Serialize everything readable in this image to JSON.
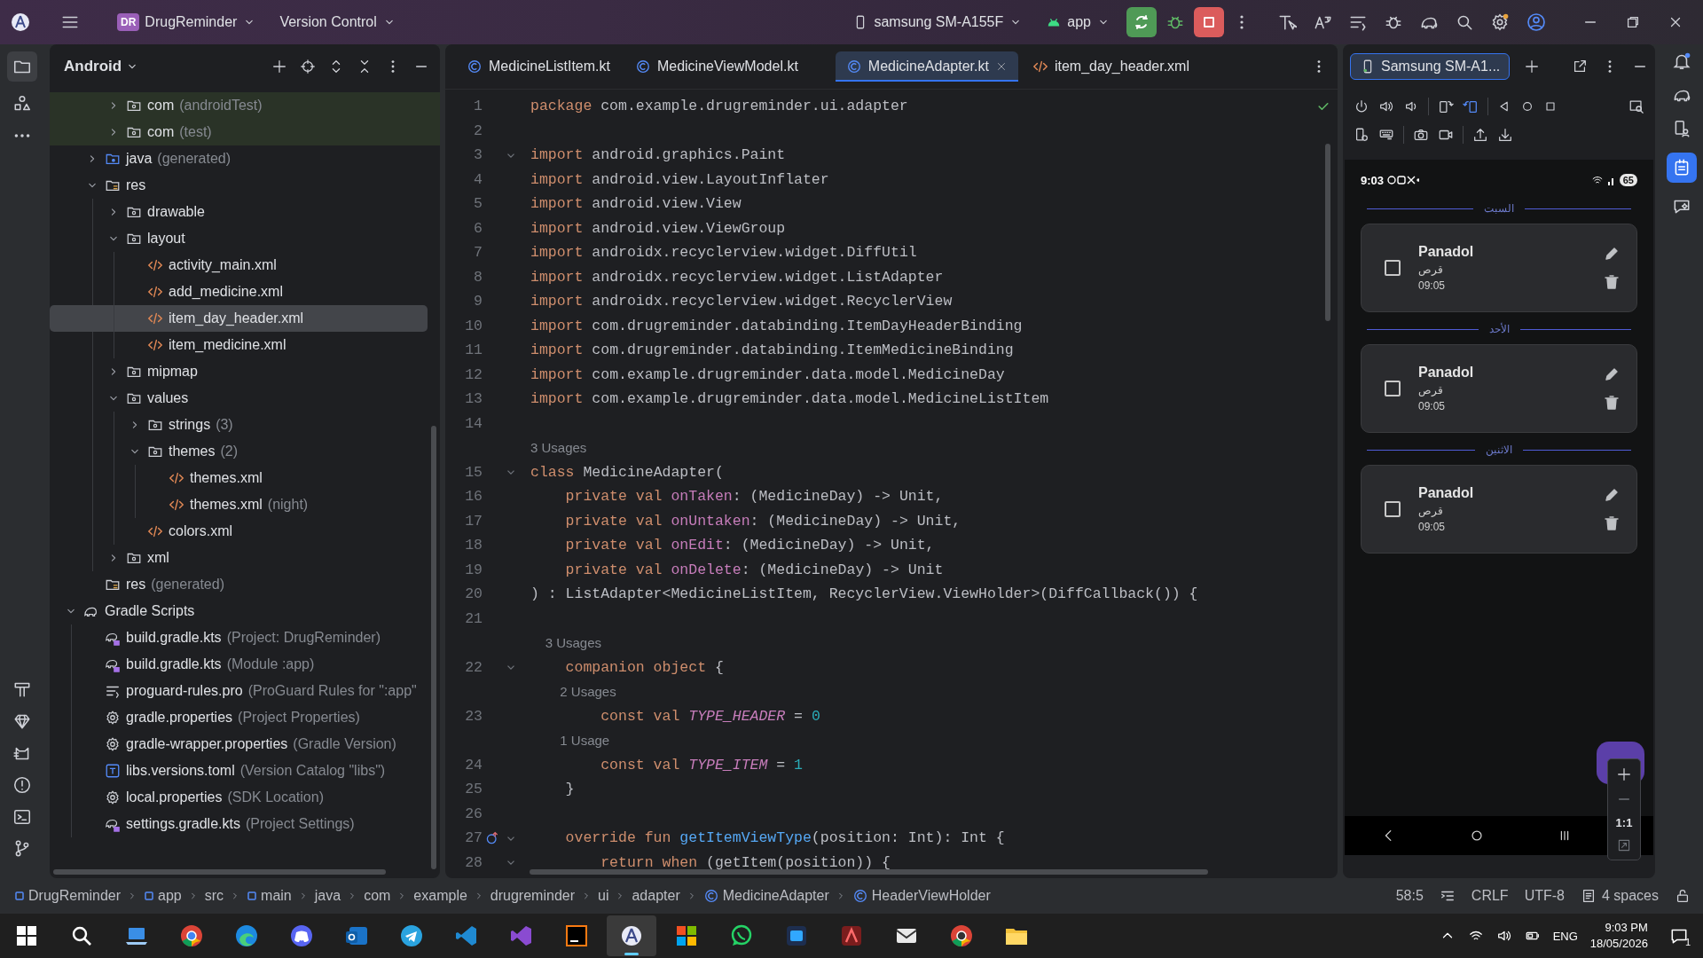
{
  "title_bar": {
    "project_badge": "DR",
    "project": "DrugReminder",
    "vcs": "Version Control",
    "device": "samsung SM-A155F",
    "run_config": "app"
  },
  "project_panel": {
    "view": "Android",
    "tree": [
      {
        "children": [
          {
            "children": [
              {
                "label": "com",
                "note": "(androidTest)",
                "kind": "package",
                "expanded": false,
                "test": true,
                "selected": false
              },
              {
                "label": "com",
                "note": "(test)",
                "kind": "package",
                "expanded": false,
                "test": true,
                "selected": false
              }
            ]
          },
          {
            "label": "java",
            "note": "(generated)",
            "kind": "generated",
            "expanded": false,
            "selected": false
          },
          {
            "label": "res",
            "kind": "res",
            "expanded": true,
            "selected": false,
            "children": [
              {
                "label": "drawable",
                "kind": "package",
                "expanded": false,
                "selected": false
              },
              {
                "label": "layout",
                "kind": "package",
                "expanded": true,
                "selected": false,
                "children": [
                  {
                    "label": "activity_main.xml",
                    "kind": "xml",
                    "selected": false
                  },
                  {
                    "label": "add_medicine.xml",
                    "kind": "xml",
                    "selected": false
                  },
                  {
                    "label": "item_day_header.xml",
                    "kind": "xml",
                    "selected": true
                  },
                  {
                    "label": "item_medicine.xml",
                    "kind": "xml",
                    "selected": false
                  }
                ]
              },
              {
                "label": "mipmap",
                "kind": "package",
                "expanded": false,
                "selected": false
              },
              {
                "label": "values",
                "kind": "package",
                "expanded": true,
                "selected": false,
                "children": [
                  {
                    "label": "strings",
                    "note": "(3)",
                    "kind": "package",
                    "expanded": false,
                    "selected": false
                  },
                  {
                    "label": "themes",
                    "note": "(2)",
                    "kind": "package",
                    "expanded": true,
                    "selected": false,
                    "children": [
                      {
                        "label": "themes.xml",
                        "kind": "xml",
                        "selected": false
                      },
                      {
                        "label": "themes.xml",
                        "note": "(night)",
                        "kind": "xml",
                        "selected": false
                      }
                    ]
                  },
                  {
                    "label": "colors.xml",
                    "kind": "xml",
                    "selected": false
                  }
                ]
              },
              {
                "label": "xml",
                "kind": "package",
                "expanded": false,
                "selected": false
              }
            ]
          },
          {
            "label": "res",
            "note": "(generated)",
            "kind": "res",
            "selected": false
          }
        ]
      },
      {
        "label": "Gradle Scripts",
        "kind": "gradle-scripts",
        "expanded": true,
        "selected": false,
        "children": [
          {
            "label": "build.gradle.kts",
            "note": "(Project: DrugReminder)",
            "kind": "gradle",
            "selected": false
          },
          {
            "label": "build.gradle.kts",
            "note": "(Module :app)",
            "kind": "gradle",
            "selected": false
          },
          {
            "label": "proguard-rules.pro",
            "note": "(ProGuard Rules for \":app\"",
            "kind": "text",
            "selected": false
          },
          {
            "label": "gradle.properties",
            "note": "(Project Properties)",
            "kind": "properties",
            "selected": false
          },
          {
            "label": "gradle-wrapper.properties",
            "note": "(Gradle Version)",
            "kind": "properties",
            "selected": false
          },
          {
            "label": "libs.versions.toml",
            "note": "(Version Catalog \"libs\")",
            "kind": "toml",
            "selected": false
          },
          {
            "label": "local.properties",
            "note": "(SDK Location)",
            "kind": "properties",
            "selected": false
          },
          {
            "label": "settings.gradle.kts",
            "note": "(Project Settings)",
            "kind": "gradle",
            "selected": false
          }
        ]
      }
    ]
  },
  "editor": {
    "tabs": [
      {
        "label": "MedicineListItem.kt",
        "kind": "kotlin",
        "selected": false
      },
      {
        "label": "MedicineViewModel.kt",
        "kind": "kotlin",
        "selected": false
      },
      {
        "label": "MedicineAdapter.kt",
        "kind": "kotlin",
        "selected": true
      },
      {
        "label": "item_day_header.xml",
        "kind": "xml",
        "selected": false
      }
    ],
    "lines": [
      {
        "kind": "code",
        "number": "1",
        "fold": false,
        "segments": [
          {
            "kind": "keyword",
            "text": "package"
          },
          {
            "kind": "plain",
            "text": " com.example.drugreminder.ui.adapter"
          }
        ]
      },
      {
        "kind": "code",
        "number": "2",
        "fold": false
      },
      {
        "kind": "code",
        "number": "3",
        "fold": true,
        "segments": [
          {
            "kind": "keyword",
            "text": "import"
          },
          {
            "kind": "plain",
            "text": " android.graphics.Paint"
          }
        ]
      },
      {
        "kind": "code",
        "number": "4",
        "fold": false,
        "segments": [
          {
            "kind": "keyword",
            "text": "import"
          },
          {
            "kind": "plain",
            "text": " android.view.LayoutInflater"
          }
        ]
      },
      {
        "kind": "code",
        "number": "5",
        "fold": false,
        "segments": [
          {
            "kind": "keyword",
            "text": "import"
          },
          {
            "kind": "plain",
            "text": " android.view.View"
          }
        ]
      },
      {
        "kind": "code",
        "number": "6",
        "fold": false,
        "segments": [
          {
            "kind": "keyword",
            "text": "import"
          },
          {
            "kind": "plain",
            "text": " android.view.ViewGroup"
          }
        ]
      },
      {
        "kind": "code",
        "number": "7",
        "fold": false,
        "segments": [
          {
            "kind": "keyword",
            "text": "import"
          },
          {
            "kind": "plain",
            "text": " androidx.recyclerview.widget.DiffUtil"
          }
        ]
      },
      {
        "kind": "code",
        "number": "8",
        "fold": false,
        "segments": [
          {
            "kind": "keyword",
            "text": "import"
          },
          {
            "kind": "plain",
            "text": " androidx.recyclerview.widget.ListAdapter"
          }
        ]
      },
      {
        "kind": "code",
        "number": "9",
        "fold": false,
        "segments": [
          {
            "kind": "keyword",
            "text": "import"
          },
          {
            "kind": "plain",
            "text": " androidx.recyclerview.widget.RecyclerView"
          }
        ]
      },
      {
        "kind": "code",
        "number": "10",
        "fold": false,
        "segments": [
          {
            "kind": "keyword",
            "text": "import"
          },
          {
            "kind": "plain",
            "text": " com.drugreminder.databinding.ItemDayHeaderBinding"
          }
        ]
      },
      {
        "kind": "code",
        "number": "11",
        "fold": false,
        "segments": [
          {
            "kind": "keyword",
            "text": "import"
          },
          {
            "kind": "plain",
            "text": " com.drugreminder.databinding.ItemMedicineBinding"
          }
        ]
      },
      {
        "kind": "code",
        "number": "12",
        "fold": false,
        "segments": [
          {
            "kind": "keyword",
            "text": "import"
          },
          {
            "kind": "plain",
            "text": " com.example.drugreminder.data.model.MedicineDay"
          }
        ]
      },
      {
        "kind": "code",
        "number": "13",
        "fold": false,
        "segments": [
          {
            "kind": "keyword",
            "text": "import"
          },
          {
            "kind": "plain",
            "text": " com.example.drugreminder.data.model.MedicineListItem"
          }
        ]
      },
      {
        "kind": "code",
        "number": "14",
        "fold": false
      },
      {
        "kind": "hint",
        "text": "3 Usages"
      },
      {
        "kind": "code",
        "number": "15",
        "fold": true,
        "segments": [
          {
            "kind": "keyword",
            "text": "class"
          },
          {
            "kind": "plain",
            "text": " MedicineAdapter("
          }
        ]
      },
      {
        "kind": "code",
        "number": "16",
        "fold": false,
        "segments": [
          {
            "kind": "keyword",
            "text": "    private val "
          },
          {
            "kind": "property",
            "text": "onTaken"
          },
          {
            "kind": "plain",
            "text": ": (MedicineDay) -> Unit,"
          }
        ]
      },
      {
        "kind": "code",
        "number": "17",
        "fold": false,
        "segments": [
          {
            "kind": "keyword",
            "text": "    private val "
          },
          {
            "kind": "property",
            "text": "onUntaken"
          },
          {
            "kind": "plain",
            "text": ": (MedicineDay) -> Unit,"
          }
        ]
      },
      {
        "kind": "code",
        "number": "18",
        "fold": false,
        "segments": [
          {
            "kind": "keyword",
            "text": "    private val "
          },
          {
            "kind": "property",
            "text": "onEdit"
          },
          {
            "kind": "plain",
            "text": ": (MedicineDay) -> Unit,"
          }
        ]
      },
      {
        "kind": "code",
        "number": "19",
        "fold": false,
        "segments": [
          {
            "kind": "keyword",
            "text": "    private val "
          },
          {
            "kind": "property",
            "text": "onDelete"
          },
          {
            "kind": "plain",
            "text": ": (MedicineDay) -> Unit"
          }
        ]
      },
      {
        "kind": "code",
        "number": "20",
        "fold": false,
        "segments": [
          {
            "kind": "plain",
            "text": ") : ListAdapter<MedicineListItem, RecyclerView.ViewHolder>(DiffCallback()) {"
          }
        ]
      },
      {
        "kind": "code",
        "number": "21",
        "fold": false
      },
      {
        "kind": "hint",
        "text": "    3 Usages"
      },
      {
        "kind": "code",
        "number": "22",
        "fold": true,
        "segments": [
          {
            "kind": "keyword",
            "text": "    companion object"
          },
          {
            "kind": "plain",
            "text": " {"
          }
        ]
      },
      {
        "kind": "hint",
        "text": "        2 Usages"
      },
      {
        "kind": "code",
        "number": "23",
        "fold": false,
        "segments": [
          {
            "kind": "keyword",
            "text": "        const val "
          },
          {
            "kind": "constant",
            "text": "TYPE_HEADER"
          },
          {
            "kind": "plain",
            "text": " = "
          },
          {
            "kind": "number",
            "text": "0"
          }
        ]
      },
      {
        "kind": "hint",
        "text": "        1 Usage"
      },
      {
        "kind": "code",
        "number": "24",
        "fold": false,
        "segments": [
          {
            "kind": "keyword",
            "text": "        const val "
          },
          {
            "kind": "constant",
            "text": "TYPE_ITEM"
          },
          {
            "kind": "plain",
            "text": " = "
          },
          {
            "kind": "number",
            "text": "1"
          }
        ]
      },
      {
        "kind": "code",
        "number": "25",
        "fold": false,
        "segments": [
          {
            "kind": "plain",
            "text": "    }"
          }
        ]
      },
      {
        "kind": "code",
        "number": "26",
        "fold": false
      },
      {
        "kind": "code",
        "number": "27",
        "fold": true,
        "override": true,
        "segments": [
          {
            "kind": "keyword",
            "text": "    override fun "
          },
          {
            "kind": "function",
            "text": "getItemViewType"
          },
          {
            "kind": "plain",
            "text": "(position: Int): Int {"
          }
        ]
      },
      {
        "kind": "code",
        "number": "28",
        "fold": true,
        "segments": [
          {
            "kind": "keyword",
            "text": "        return when"
          },
          {
            "kind": "plain",
            "text": " (getItem(position)) {"
          }
        ]
      }
    ]
  },
  "devices_panel": {
    "tab": "Samsung SM-A1...",
    "phone": {
      "time": "9:03",
      "battery": "65",
      "zoom_label": "1:1",
      "days": [
        {
          "title": "السبت",
          "items": [
            {
              "name": "Panadol",
              "form": "قرص",
              "time": "09:05",
              "checked": false
            }
          ]
        },
        {
          "title": "الأحد",
          "items": [
            {
              "name": "Panadol",
              "form": "قرص",
              "time": "09:05",
              "checked": false
            }
          ]
        },
        {
          "title": "الاثنين",
          "items": [
            {
              "name": "Panadol",
              "form": "قرص",
              "time": "09:05",
              "checked": false
            }
          ]
        }
      ]
    }
  },
  "status_bar": {
    "breadcrumbs": [
      {
        "label": "DrugReminder",
        "kind": "module"
      },
      {
        "label": "app",
        "kind": "module"
      },
      {
        "label": "src",
        "kind": "plain"
      },
      {
        "label": "main",
        "kind": "module"
      },
      {
        "label": "java",
        "kind": "plain"
      },
      {
        "label": "com",
        "kind": "plain"
      },
      {
        "label": "example",
        "kind": "plain"
      },
      {
        "label": "drugreminder",
        "kind": "plain"
      },
      {
        "label": "ui",
        "kind": "plain"
      },
      {
        "label": "adapter",
        "kind": "plain"
      },
      {
        "label": "MedicineAdapter",
        "kind": "class"
      },
      {
        "label": "HeaderViewHolder",
        "kind": "class"
      }
    ],
    "position": "58:5",
    "line_ending": "CRLF",
    "encoding": "UTF-8",
    "indent": "4 spaces"
  },
  "taskbar": {
    "apps": [
      {
        "kind": "start",
        "selected": false
      },
      {
        "kind": "search",
        "selected": false
      },
      {
        "kind": "laptop",
        "selected": false
      },
      {
        "kind": "chrome",
        "selected": false
      },
      {
        "kind": "edge",
        "selected": false
      },
      {
        "kind": "discord",
        "selected": false
      },
      {
        "kind": "mail",
        "selected": false
      },
      {
        "kind": "telegram",
        "selected": false
      },
      {
        "kind": "vscode",
        "selected": false
      },
      {
        "kind": "vs",
        "selected": false
      },
      {
        "kind": "jetbrains",
        "selected": false
      },
      {
        "kind": "studio",
        "selected": true
      },
      {
        "kind": "tiles",
        "selected": false
      },
      {
        "kind": "whatsapp",
        "selected": false
      },
      {
        "kind": "blue-app",
        "selected": false
      },
      {
        "kind": "red-app",
        "selected": false
      },
      {
        "kind": "envelope",
        "selected": false
      },
      {
        "kind": "chrome-dark",
        "selected": false
      },
      {
        "kind": "folder",
        "selected": false
      }
    ],
    "language": "ENG",
    "time": "9:03 PM",
    "date": "18/05/2026",
    "notifications": "1"
  }
}
